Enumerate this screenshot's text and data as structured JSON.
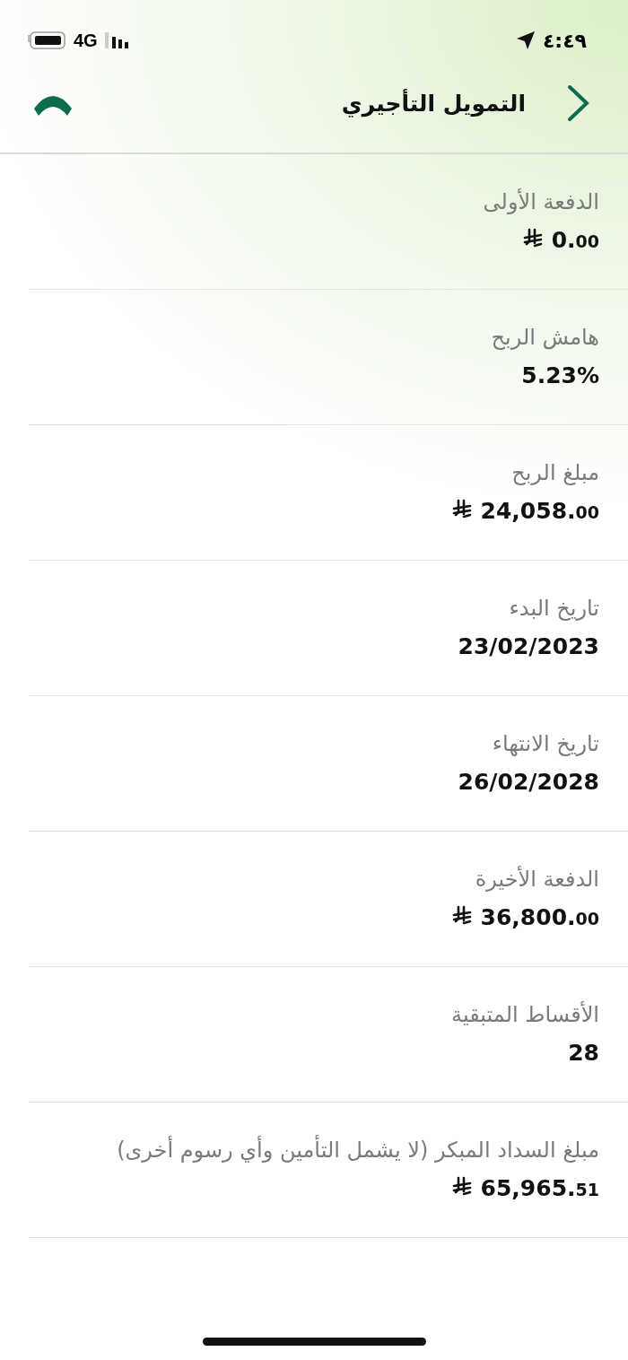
{
  "status_bar": {
    "time": "٤:٤٩",
    "network": "4G"
  },
  "header": {
    "title": "التمويل التأجيري"
  },
  "items": [
    {
      "label": "الدفعة الأولى",
      "kind": "money",
      "amount": "0.",
      "fraction": "00"
    },
    {
      "label": "هامش الربح",
      "kind": "plain",
      "value": "5.23%"
    },
    {
      "label": "مبلغ الربح",
      "kind": "money",
      "amount": "24,058.",
      "fraction": "00"
    },
    {
      "label": "تاريخ البدء",
      "kind": "plain",
      "value": "23/02/2023"
    },
    {
      "label": "تاريخ الانتهاء",
      "kind": "plain",
      "value": "26/02/2028"
    },
    {
      "label": "الدفعة الأخيرة",
      "kind": "money",
      "amount": "36,800.",
      "fraction": "00"
    },
    {
      "label": "الأقساط المتبقية",
      "kind": "plain",
      "value": "28"
    },
    {
      "label": "مبلغ السداد المبكر (لا يشمل التأمين وأي رسوم أخرى)",
      "kind": "money",
      "amount": "65,965.",
      "fraction": "51"
    }
  ]
}
